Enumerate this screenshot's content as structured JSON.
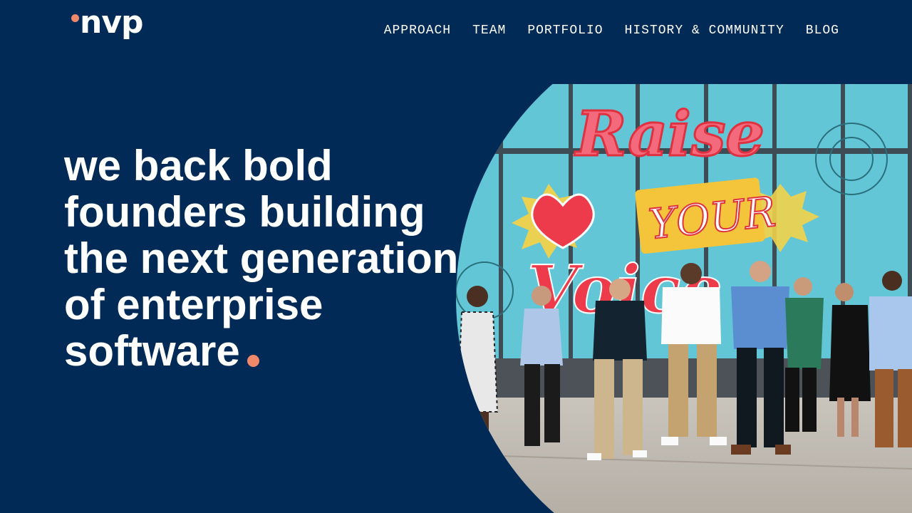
{
  "brand": {
    "logo_text": "nvp",
    "logo_icon": "logo-dot-icon",
    "accent_color": "#f0896a",
    "background_color": "#022a56"
  },
  "nav": {
    "items": [
      {
        "label": "APPROACH"
      },
      {
        "label": "TEAM"
      },
      {
        "label": "PORTFOLIO"
      },
      {
        "label": "HISTORY & COMMUNITY"
      },
      {
        "label": "BLOG"
      }
    ]
  },
  "hero": {
    "line1": "we back bold",
    "line2": "founders building",
    "line3": "the next generation",
    "line4": "of enterprise",
    "line5": "software"
  },
  "mural": {
    "word1": "Raise",
    "word2": "YOUR",
    "word3": "Voice"
  }
}
